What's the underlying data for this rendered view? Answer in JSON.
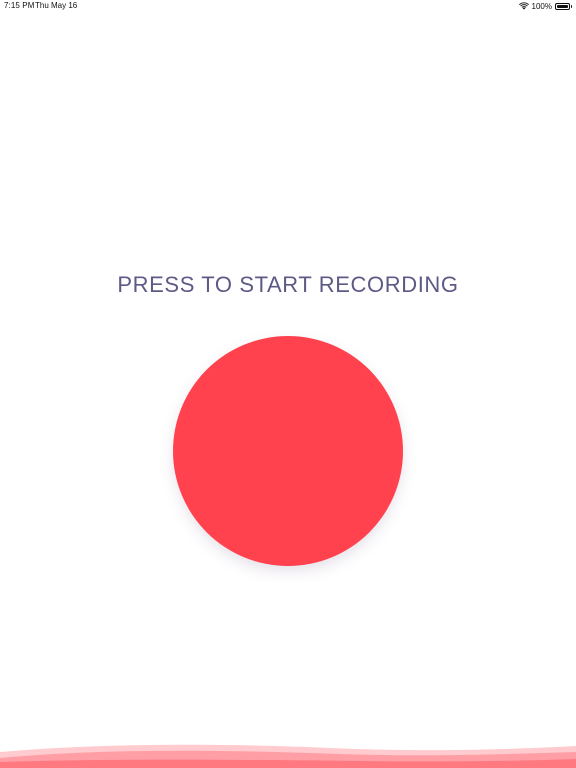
{
  "status_bar": {
    "time": "7:15 PM",
    "date": "Thu May 16",
    "battery": "100%",
    "battery_level": 1.0,
    "icons": [
      "wifi-icon",
      "battery-icon"
    ]
  },
  "main": {
    "prompt": "PRESS TO START RECORDING"
  },
  "colors": {
    "accent": "#ff424e",
    "prompt_text": "#5d5a85",
    "wave": "#ff6b74",
    "background": "#ffffff"
  }
}
